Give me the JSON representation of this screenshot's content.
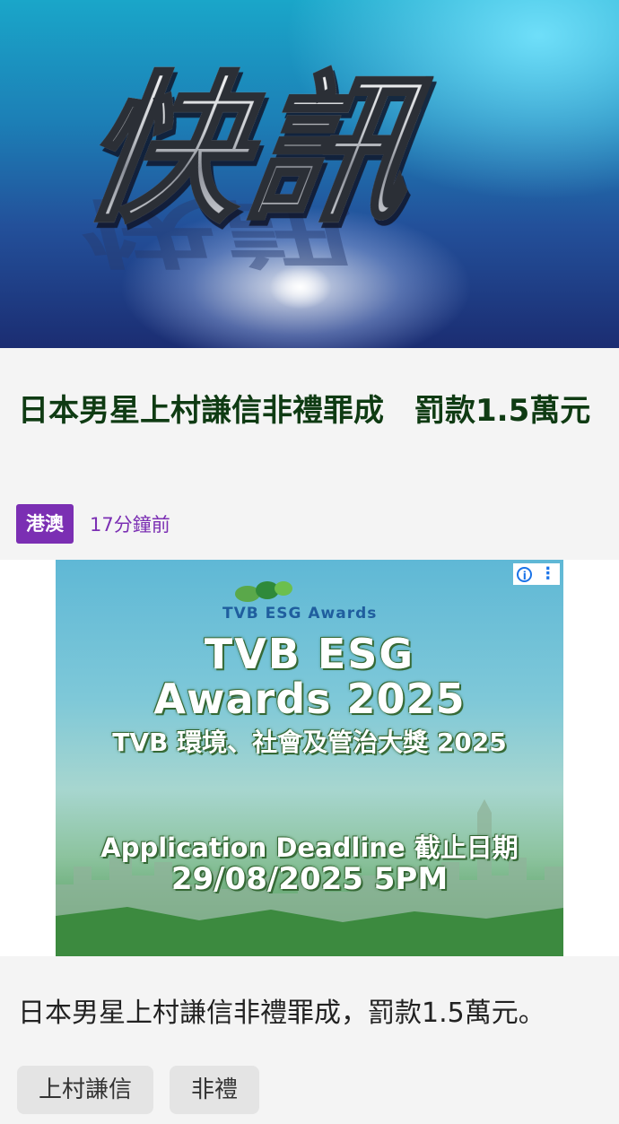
{
  "hero": {
    "title": "快訊",
    "reflection": "快訊"
  },
  "article": {
    "headline": "日本男星上村謙信非禮罪成　罰款1.5萬元",
    "category": "港澳",
    "time": "17分鐘前",
    "summary": "日本男星上村謙信非禮罪成，罰款1.5萬元。",
    "tags": [
      "上村謙信",
      "非禮"
    ]
  },
  "ad": {
    "info_icon": "i",
    "menu_icon": "⋮",
    "logo_text": "TVB ESG Awards",
    "line1": "TVB ESG",
    "line2": "Awards 2025",
    "line3": "TVB 環境、社會及管治大獎 2025",
    "line4": "Application Deadline 截止日期",
    "line5": "29/08/2025 5PM"
  },
  "colors": {
    "headline": "#0f3b13",
    "category_bg": "#7b2fb3",
    "time": "#7b2fb3",
    "chip_bg": "#e4e4e4"
  }
}
